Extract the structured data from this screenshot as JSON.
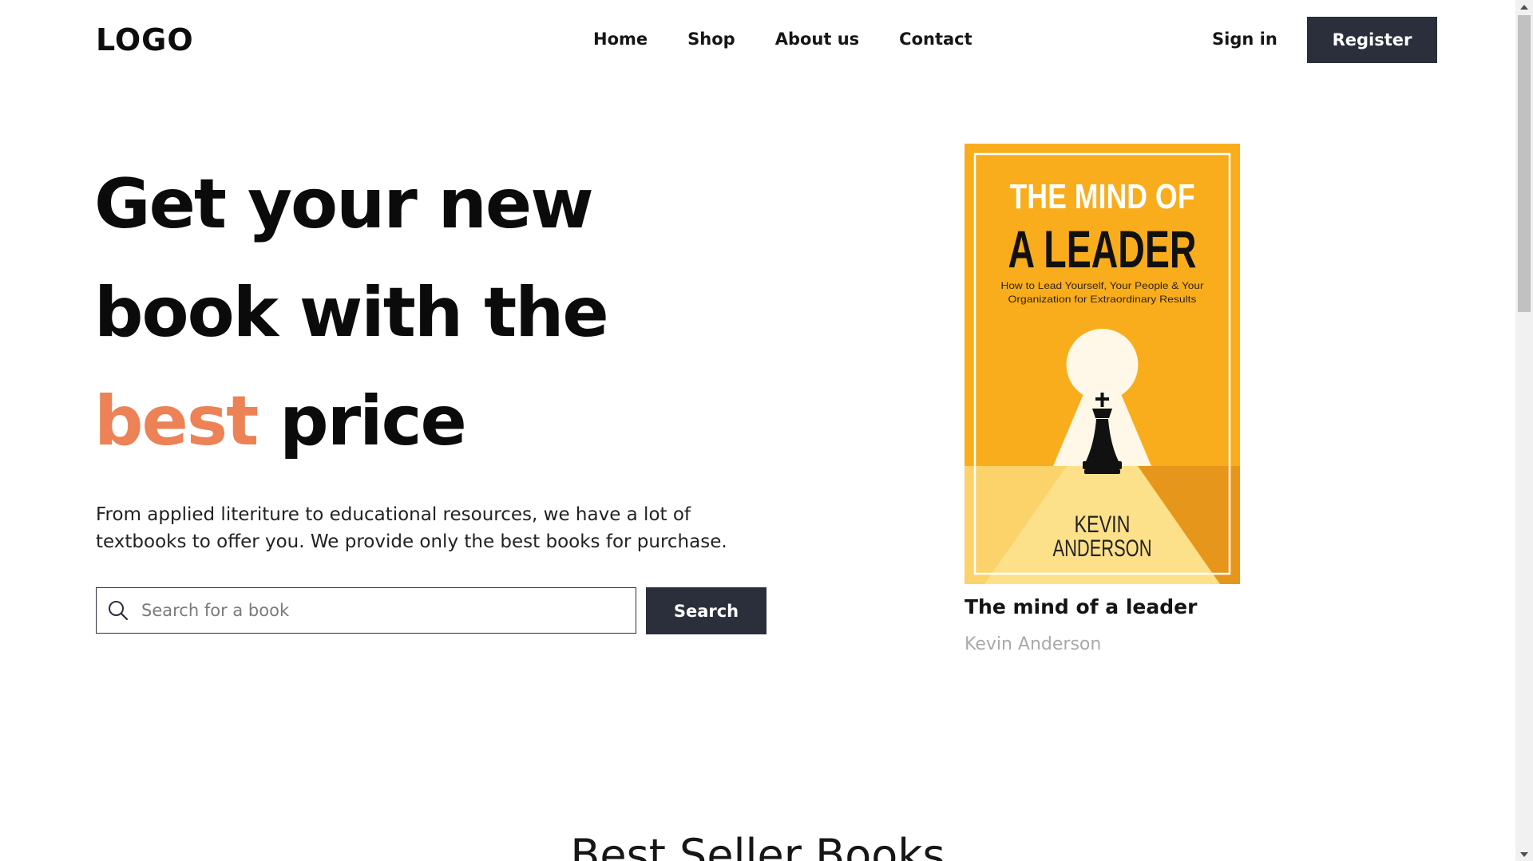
{
  "header": {
    "logo": "LOGO",
    "nav": [
      "Home",
      "Shop",
      "About us",
      "Contact"
    ],
    "sign_in": "Sign in",
    "register": "Register"
  },
  "hero": {
    "title_line1": "Get your new",
    "title_line2": "book with the",
    "title_accent": "best",
    "title_end": " price",
    "description": "From applied literiture to educational resources, we have a lot of textbooks to offer you. We provide only the best books for purchase.",
    "search_placeholder": "Search for a book",
    "search_button": "Search"
  },
  "featured_book": {
    "cover": {
      "title_line1": "THE MIND OF",
      "title_line2": "A LEADER",
      "subtitle_line1": "How to Lead Yourself, Your People & Your",
      "subtitle_line2": "Organization for Extraordinary Results",
      "author_line1": "KEVIN",
      "author_line2": "ANDERSON"
    },
    "title": "The mind of a leader",
    "author": "Kevin Anderson"
  },
  "sections": {
    "best_sellers_title": "Best Seller Books"
  },
  "colors": {
    "accent": "#ec8255",
    "dark_button": "#2b2e3b",
    "cover_yellow": "#f9ad1c",
    "muted_text": "#a9a9a9"
  }
}
